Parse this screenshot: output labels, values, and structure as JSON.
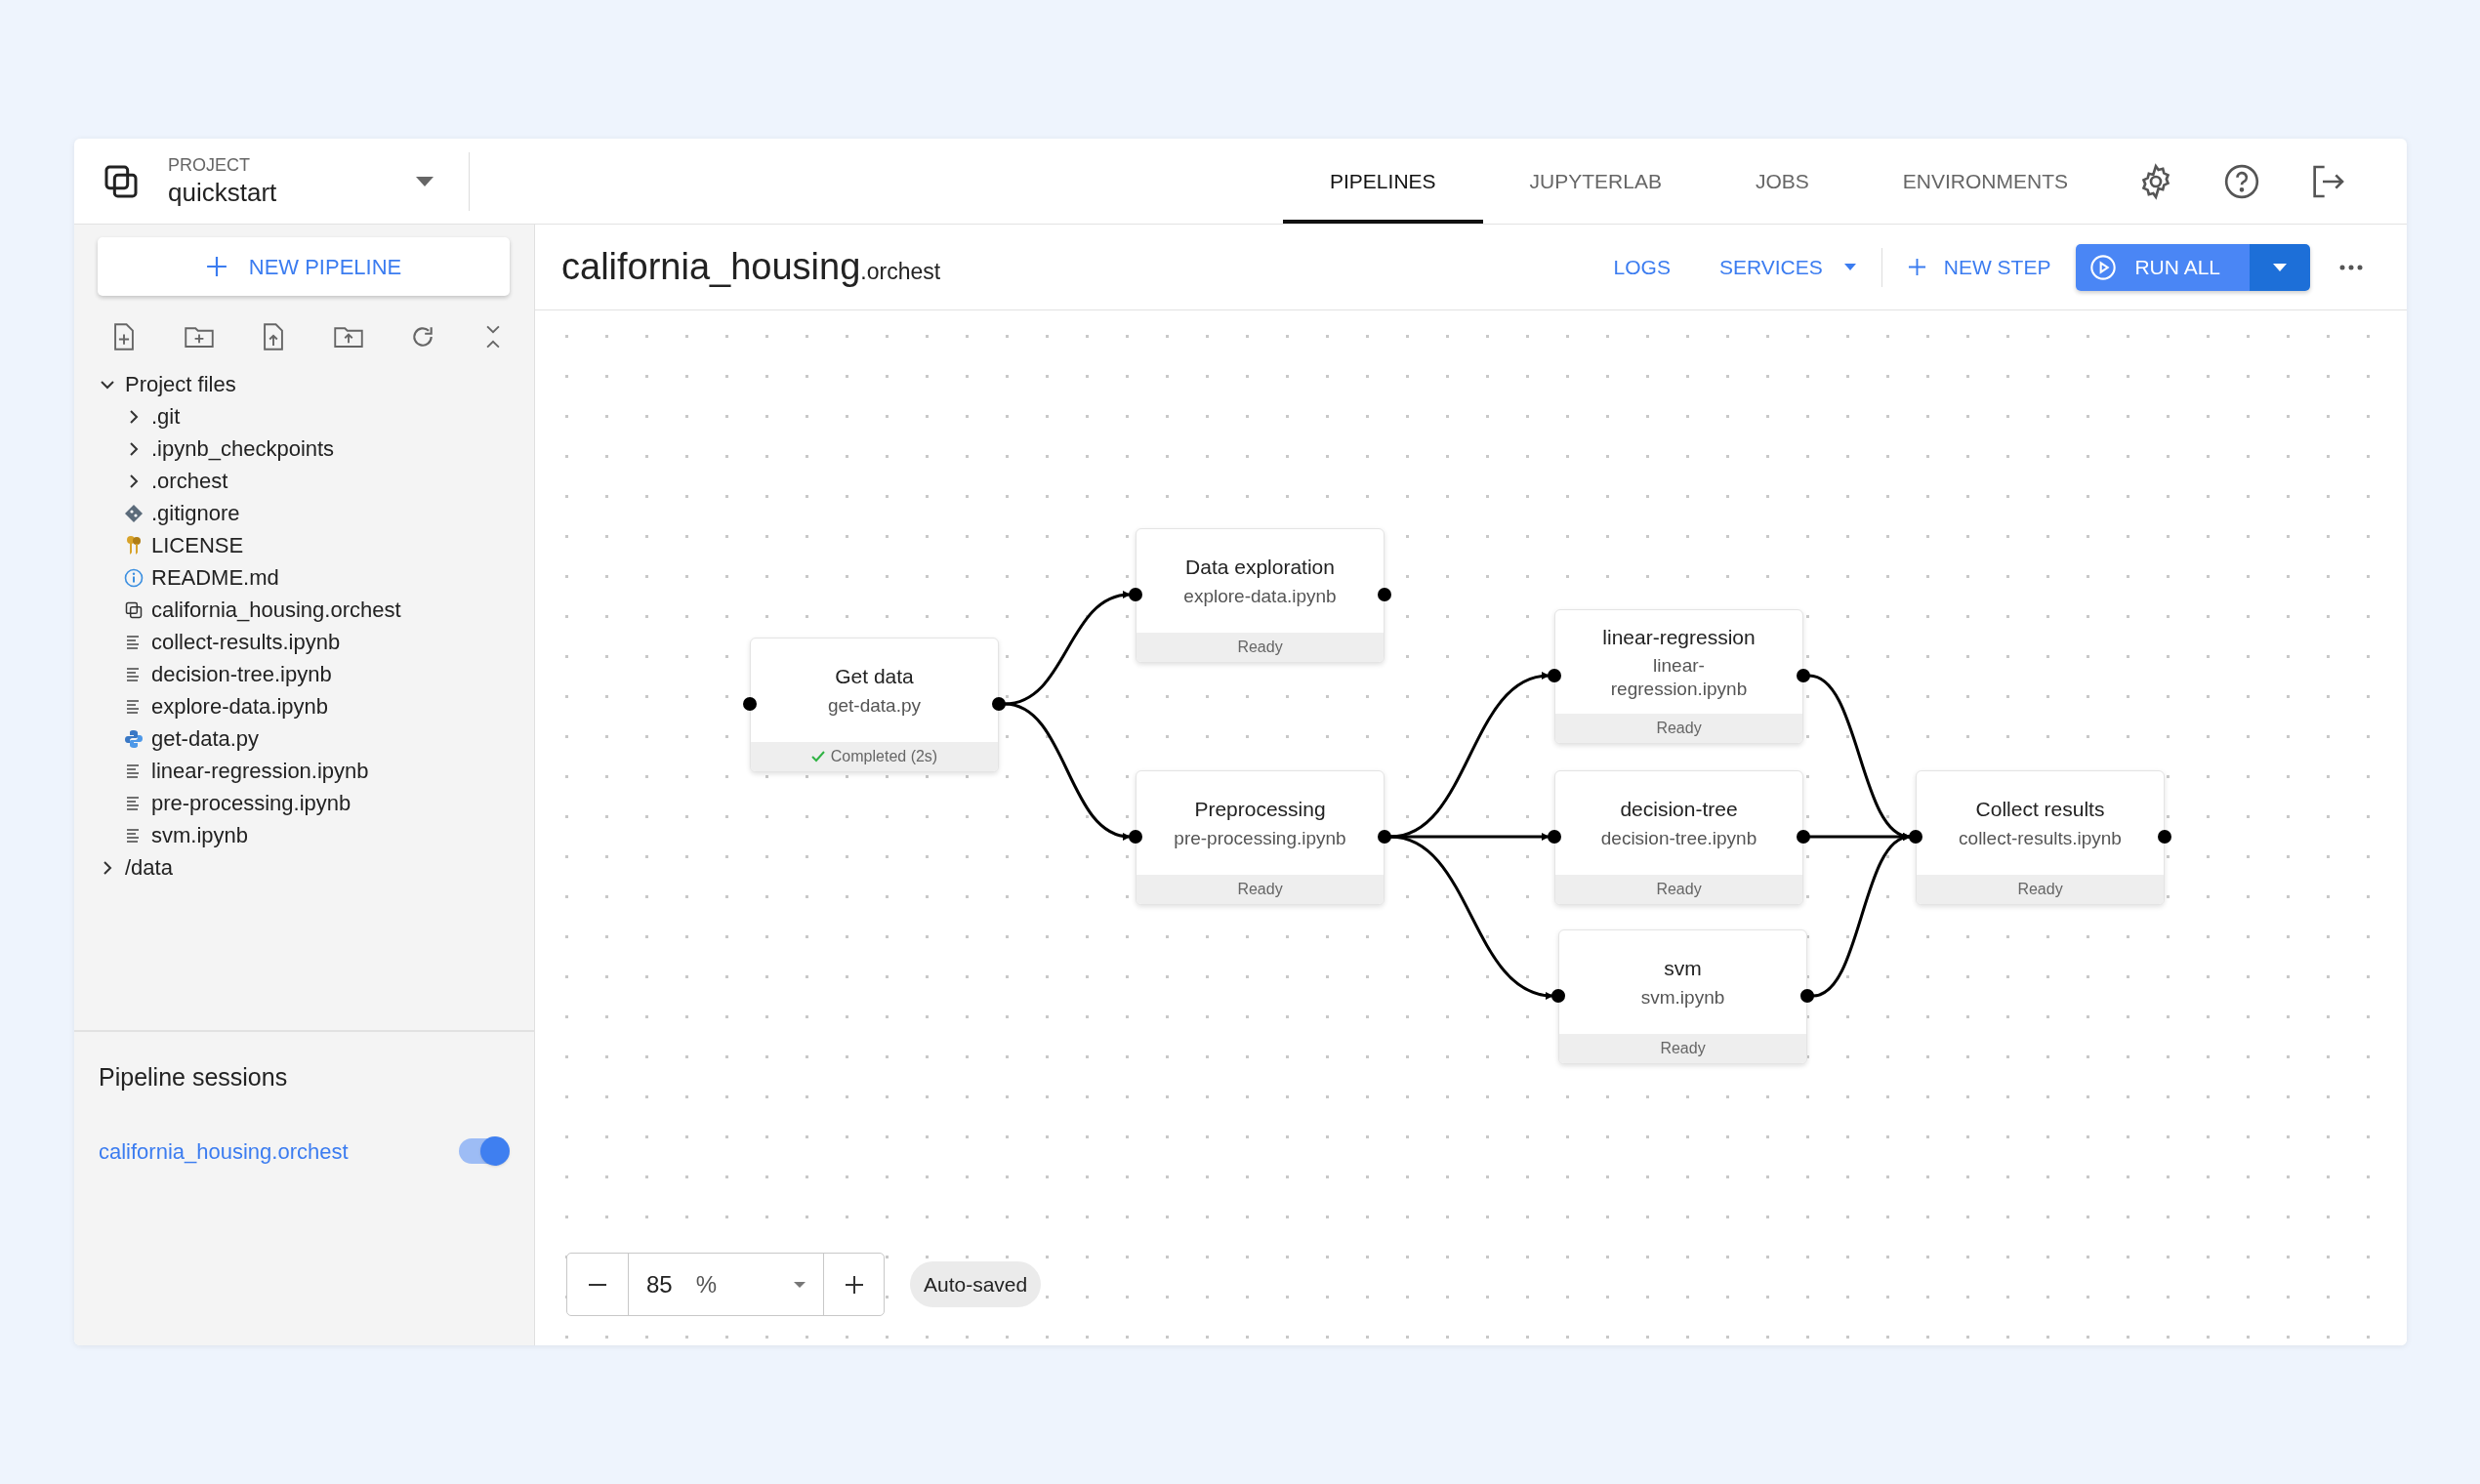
{
  "header": {
    "project_label": "PROJECT",
    "project_name": "quickstart",
    "tabs": [
      {
        "label": "PIPELINES",
        "selected": true
      },
      {
        "label": "JUPYTERLAB",
        "selected": false
      },
      {
        "label": "JOBS",
        "selected": false
      },
      {
        "label": "ENVIRONMENTS",
        "selected": false
      }
    ]
  },
  "sidebar": {
    "new_pipeline": "NEW PIPELINE",
    "files": [
      {
        "label": "Project files",
        "kind": "folder",
        "expanded": true,
        "children": [
          {
            "label": ".git",
            "kind": "folder",
            "expanded": false
          },
          {
            "label": ".ipynb_checkpoints",
            "kind": "folder",
            "expanded": false
          },
          {
            "label": ".orchest",
            "kind": "folder",
            "expanded": false
          },
          {
            "label": ".gitignore",
            "kind": "git"
          },
          {
            "label": "LICENSE",
            "kind": "license"
          },
          {
            "label": "README.md",
            "kind": "info"
          },
          {
            "label": "california_housing.orchest",
            "kind": "pipeline"
          },
          {
            "label": "collect-results.ipynb",
            "kind": "notebook"
          },
          {
            "label": "decision-tree.ipynb",
            "kind": "notebook"
          },
          {
            "label": "explore-data.ipynb",
            "kind": "notebook"
          },
          {
            "label": "get-data.py",
            "kind": "python"
          },
          {
            "label": "linear-regression.ipynb",
            "kind": "notebook"
          },
          {
            "label": "pre-processing.ipynb",
            "kind": "notebook"
          },
          {
            "label": "svm.ipynb",
            "kind": "notebook"
          }
        ]
      },
      {
        "label": "/data",
        "kind": "folder",
        "expanded": false
      }
    ],
    "sessions_title": "Pipeline sessions",
    "sessions": [
      {
        "label": "california_housing.orchest",
        "on": true
      }
    ]
  },
  "toolbar": {
    "pipeline_name": "california_housing",
    "pipeline_extension": ".orchest",
    "logs": "LOGS",
    "services": "SERVICES",
    "new_step": "NEW STEP",
    "run_all": "RUN ALL"
  },
  "canvas": {
    "steps": [
      {
        "title": "Get data",
        "file": "get-data.py",
        "status": "Completed (2s)",
        "completed": true
      },
      {
        "title": "Data exploration",
        "file": "explore-data.ipynb",
        "status": "Ready",
        "completed": false
      },
      {
        "title": "Preprocessing",
        "file": "pre-processing.ipynb",
        "status": "Ready",
        "completed": false
      },
      {
        "title": "linear-regression",
        "file": "linear-regression.ipynb",
        "status": "Ready",
        "completed": false
      },
      {
        "title": "decision-tree",
        "file": "decision-tree.ipynb",
        "status": "Ready",
        "completed": false
      },
      {
        "title": "svm",
        "file": "svm.ipynb",
        "status": "Ready",
        "completed": false
      },
      {
        "title": "Collect results",
        "file": "collect-results.ipynb",
        "status": "Ready",
        "completed": false
      }
    ],
    "zoom": {
      "value": "85",
      "unit": "%"
    },
    "save_state": "Auto-saved"
  }
}
